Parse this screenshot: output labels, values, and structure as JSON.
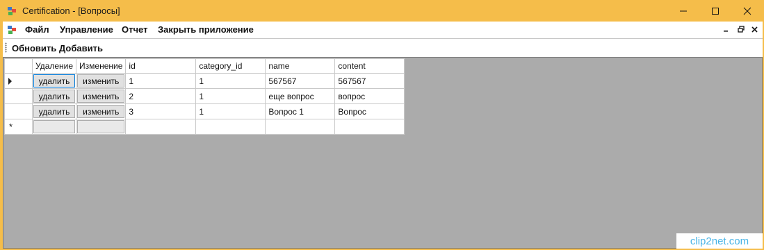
{
  "window": {
    "title": "Certification - [Вопросы]",
    "controls": [
      "minimize",
      "maximize",
      "close"
    ]
  },
  "menu": {
    "items": [
      "Файл",
      "Управление",
      "Отчет",
      "Закрыть приложение"
    ]
  },
  "toolbar": {
    "refresh_label": "Обновить",
    "add_label": "Добавить"
  },
  "grid": {
    "columns": [
      "Удаление",
      "Изменение",
      "id",
      "category_id",
      "name",
      "content"
    ],
    "rows": [
      {
        "delete_label": "удалить",
        "edit_label": "изменить",
        "id": "1",
        "category_id": "1",
        "name": "567567",
        "content": "567567"
      },
      {
        "delete_label": "удалить",
        "edit_label": "изменить",
        "id": "2",
        "category_id": "1",
        "name": "еще вопрос",
        "content": "вопрос"
      },
      {
        "delete_label": "удалить",
        "edit_label": "изменить",
        "id": "3",
        "category_id": "1",
        "name": "Вопрос 1",
        "content": "Вопрос"
      }
    ],
    "current_row_marker": "▶",
    "new_row_marker": "*"
  },
  "watermark": {
    "text": "clip2net.com"
  },
  "colors": {
    "titlebar": "#f5bd4a",
    "grid_background": "#ababab",
    "focus_border": "#0078d7"
  },
  "icons": [
    "app-icon",
    "minimize-icon",
    "maximize-icon",
    "close-icon",
    "mdi-app-icon",
    "mdi-minimize-icon",
    "mdi-restore-icon",
    "mdi-close-icon",
    "toolbar-grip-icon",
    "current-row-arrow-icon",
    "new-row-asterisk-icon"
  ]
}
